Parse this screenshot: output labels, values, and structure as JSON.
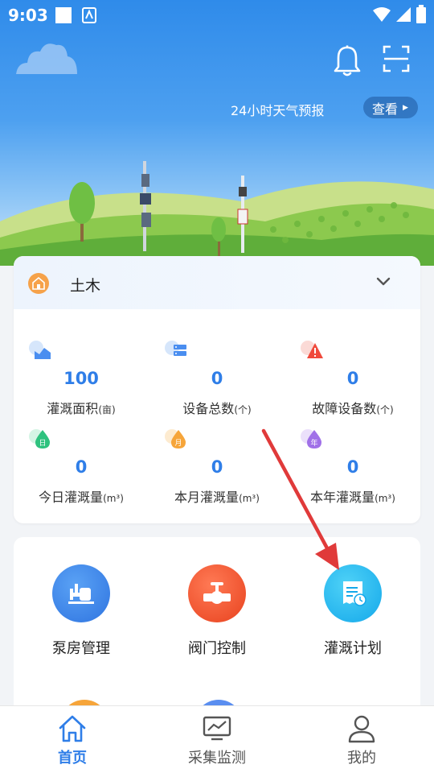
{
  "status_bar": {
    "time": "9:03"
  },
  "header": {
    "weather_text": "24小时天气预报",
    "view_button_label": "查看"
  },
  "site": {
    "name": "土木"
  },
  "stats": [
    {
      "icon": "area-icon",
      "value": "100",
      "label": "灌溉面积",
      "unit": "(亩)"
    },
    {
      "icon": "device-icon",
      "value": "0",
      "label": "设备总数",
      "unit": "(个)"
    },
    {
      "icon": "warning-icon",
      "value": "0",
      "label": "故障设备数",
      "unit": "(个)"
    },
    {
      "icon": "day-icon",
      "value": "0",
      "label": "今日灌溉量",
      "unit": "(m³)"
    },
    {
      "icon": "month-icon",
      "value": "0",
      "label": "本月灌溉量",
      "unit": "(m³)"
    },
    {
      "icon": "year-icon",
      "value": "0",
      "label": "本年灌溉量",
      "unit": "(m³)"
    }
  ],
  "stat_icon_glyphs": {
    "day": "日",
    "month": "月",
    "year": "年"
  },
  "functions": [
    {
      "icon": "pump-icon",
      "label": "泵房管理",
      "color": "#3b86e8"
    },
    {
      "icon": "valve-icon",
      "label": "阀门控制",
      "color": "#f0532c"
    },
    {
      "icon": "schedule-icon",
      "label": "灌溉计划",
      "color": "#22b3ee"
    }
  ],
  "bottom_nav": [
    {
      "icon": "home-icon",
      "label": "首页",
      "active": true
    },
    {
      "icon": "monitor-icon",
      "label": "采集监测",
      "active": false
    },
    {
      "icon": "user-icon",
      "label": "我的",
      "active": false
    }
  ],
  "colors": {
    "accent": "#2f7ee8",
    "annotation_arrow": "#e03a3a"
  }
}
